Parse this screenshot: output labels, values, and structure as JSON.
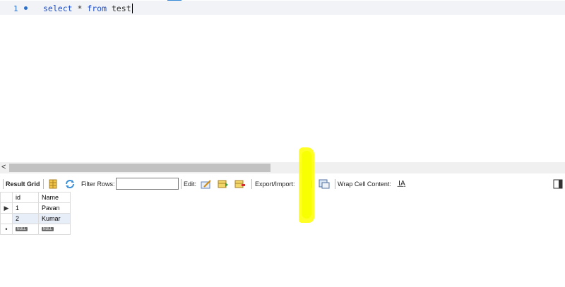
{
  "editor": {
    "line_number": "1",
    "code_kw1": "select",
    "code_star": " * ",
    "code_kw2": "from",
    "code_table": " test"
  },
  "scrollbar": {
    "left_arrow": "<"
  },
  "toolbar": {
    "result_grid": "Result Grid",
    "filter_label": "Filter Rows:",
    "filter_value": "",
    "edit_label": "Edit:",
    "export_label": "Export/Import:",
    "wrap_label": "Wrap Cell Content:",
    "wrap_icon": "I͟A"
  },
  "grid": {
    "columns": [
      "id",
      "Name"
    ],
    "rows": [
      {
        "id": "1",
        "name": "Pavan"
      },
      {
        "id": "2",
        "name": "Kumar"
      }
    ],
    "new_row": {
      "id": "NULL",
      "name": "NULL"
    }
  },
  "colors": {
    "highlight": "#ffff00",
    "keyword": "#1f4fc8"
  }
}
